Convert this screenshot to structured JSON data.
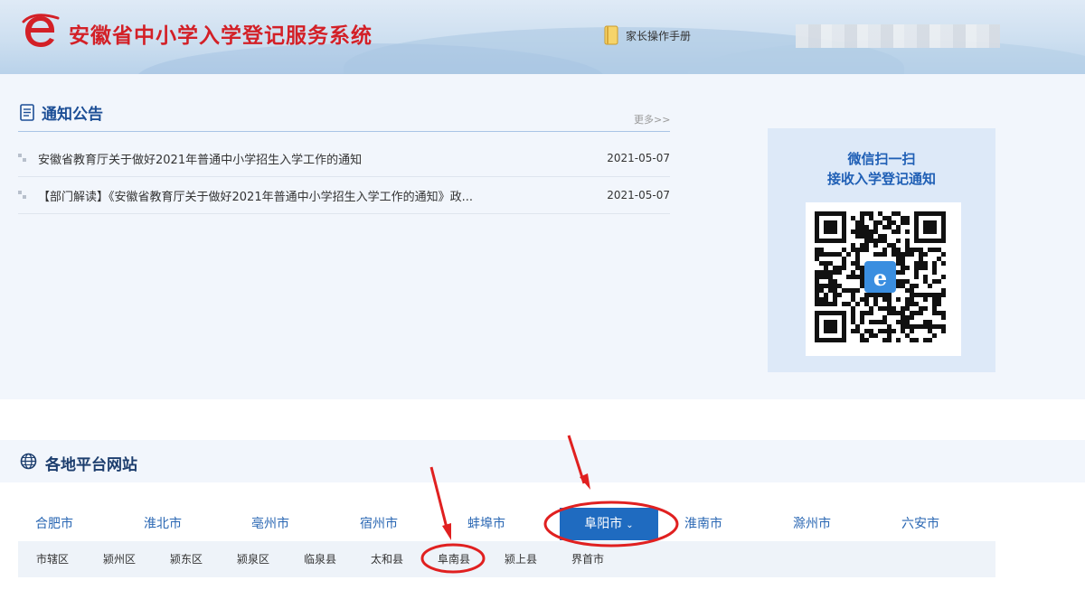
{
  "header": {
    "title": "安徽省中小学入学登记服务系统",
    "manual_label": "家长操作手册",
    "logo_icon": "e-logo-icon",
    "manual_icon": "book-icon"
  },
  "notice": {
    "heading": "通知公告",
    "more_label": "更多>>",
    "items": [
      {
        "title": "安徽省教育厅关于做好2021年普通中小学招生入学工作的通知",
        "date": "2021-05-07"
      },
      {
        "title": "【部门解读】《安徽省教育厅关于做好2021年普通中小学招生入学工作的通知》政...",
        "date": "2021-05-07"
      }
    ]
  },
  "qr": {
    "line1": "微信扫一扫",
    "line2": "接收入学登记通知"
  },
  "platform": {
    "heading": "各地平台网站",
    "cities": [
      {
        "label": "合肥市"
      },
      {
        "label": "淮北市"
      },
      {
        "label": "亳州市"
      },
      {
        "label": "宿州市"
      },
      {
        "label": "蚌埠市"
      },
      {
        "label": "阜阳市",
        "active": true,
        "chevron": "⌄"
      },
      {
        "label": "淮南市"
      },
      {
        "label": "滁州市"
      },
      {
        "label": "六安市"
      }
    ],
    "counties": [
      {
        "label": "市辖区"
      },
      {
        "label": "颍州区"
      },
      {
        "label": "颍东区"
      },
      {
        "label": "颍泉区"
      },
      {
        "label": "临泉县"
      },
      {
        "label": "太和县"
      },
      {
        "label": "阜南县"
      },
      {
        "label": "颍上县"
      },
      {
        "label": "界首市"
      }
    ]
  },
  "colors": {
    "brand_red": "#d32027",
    "primary_blue": "#1f6bc0",
    "annotation_red": "#e02020"
  }
}
